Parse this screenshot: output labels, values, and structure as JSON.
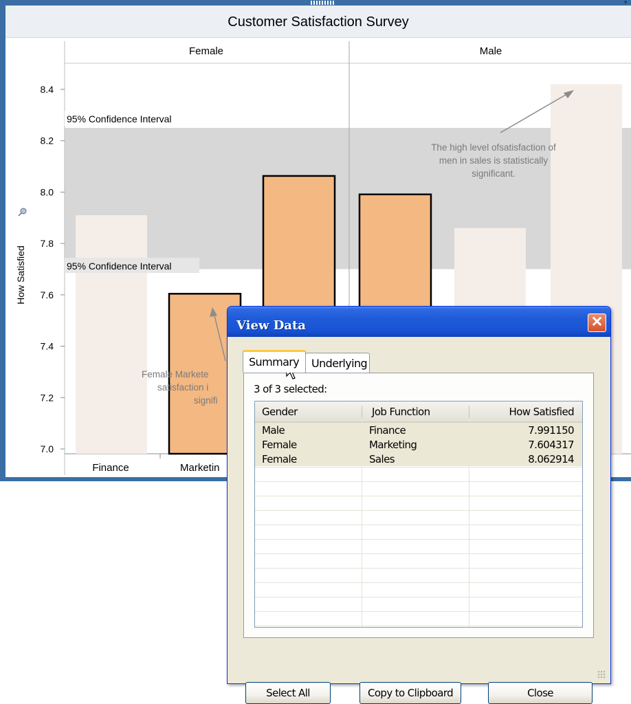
{
  "chart": {
    "title": "Customer Satisfaction Survey",
    "panels": [
      "Female",
      "Male"
    ],
    "ylabel": "How Satisfied",
    "yticks": [
      "8.4",
      "8.2",
      "8.0",
      "7.8",
      "7.6",
      "7.4",
      "7.2",
      "7.0"
    ],
    "band_label_top": "95% Confidence Interval",
    "band_label_bottom": "95% Confidence Interval",
    "xlabels_visible": [
      "Finance",
      "Marketin"
    ],
    "annotation_male": [
      "The high level ofsatisfaction of",
      "men in sales is statistically",
      "significant."
    ],
    "annotation_female_visible": [
      "Female Markete",
      "satisfaction i",
      "signifi"
    ],
    "colors": {
      "highlight_bar": "#f4b882",
      "faded_bar": "#f5ede8",
      "confidence_band": "#d7d7d7",
      "frame": "#3a6ea5"
    }
  },
  "chart_data": {
    "type": "bar",
    "title": "Customer Satisfaction Survey",
    "ylabel": "How Satisfied",
    "ylim": [
      7.0,
      8.45
    ],
    "yticks": [
      7.0,
      7.2,
      7.4,
      7.6,
      7.8,
      8.0,
      8.2,
      8.4
    ],
    "categories": [
      "Finance",
      "Marketing",
      "Sales"
    ],
    "series": [
      {
        "name": "Female",
        "values": [
          7.91,
          7.604317,
          8.062914
        ],
        "selected": [
          false,
          true,
          true
        ]
      },
      {
        "name": "Male",
        "values": [
          7.99115,
          7.86,
          8.42
        ],
        "selected": [
          true,
          false,
          false
        ]
      }
    ],
    "confidence_interval": [
      7.7,
      8.25
    ]
  },
  "dialog": {
    "title": "View Data",
    "close_glyph": "✕",
    "tabs": [
      "Summary",
      "Underlying"
    ],
    "selected_text": "3 of 3 selected:",
    "columns": [
      "Gender",
      "Job Function",
      "How Satisfied"
    ],
    "rows": [
      [
        "Male",
        "Finance",
        "7.991150"
      ],
      [
        "Female",
        "Marketing",
        "7.604317"
      ],
      [
        "Female",
        "Sales",
        "8.062914"
      ]
    ],
    "buttons": {
      "select_all": "Select All",
      "copy": "Copy to Clipboard",
      "close": "Close"
    }
  }
}
